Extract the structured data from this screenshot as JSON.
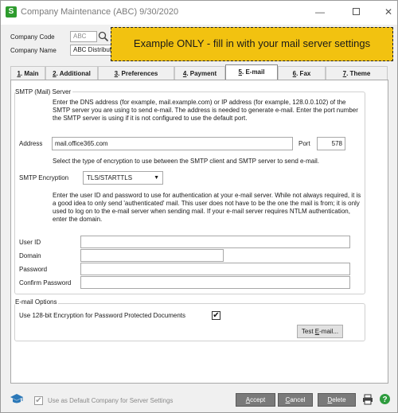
{
  "window": {
    "app_icon_letter": "S",
    "title": "Company Maintenance (ABC) 9/30/2020",
    "controls": {
      "minimize": "—",
      "close": "✕"
    }
  },
  "header": {
    "company_code_label": "Company Code",
    "company_code_value": "ABC",
    "company_name_label": "Company Name",
    "company_name_value": "ABC Distribution"
  },
  "callout": "Example ONLY - fill in with your mail server settings",
  "tabs": [
    {
      "key": "1",
      "label": ". Main"
    },
    {
      "key": "2",
      "label": ". Additional"
    },
    {
      "key": "3",
      "label": ". Preferences"
    },
    {
      "key": "4",
      "label": ". Payment"
    },
    {
      "key": "5",
      "label": ". E-mail"
    },
    {
      "key": "6",
      "label": ". Fax"
    },
    {
      "key": "7",
      "label": ". Theme"
    }
  ],
  "smtp": {
    "group_title": "SMTP (Mail) Server",
    "address_desc": "Enter the DNS address (for example, mail.example.com) or IP address (for example, 128.0.0.102) of the SMTP server you are using to send e-mail. The address is needed to generate e-mail. Enter the port number the SMTP server is using if it is not configured to use the default port.",
    "address_label": "Address",
    "address_value": "mail.office365.com",
    "port_label": "Port",
    "port_value": "578",
    "encryption_desc": "Select the type of encryption to use between the SMTP client and SMTP server to send e-mail.",
    "encryption_label": "SMTP Encryption",
    "encryption_value": "TLS/STARTTLS",
    "auth_desc": "Enter the user ID and password to use for authentication at your e-mail server.  While not always required, it is a good idea to only send 'authenticated' mail.  This user does not have to be the one the mail is from; it is only used to log on to the e-mail server when sending mail.  If your e-mail server requires NTLM authentication, enter the domain.",
    "user_id_label": "User ID",
    "user_id_value": "",
    "domain_label": "Domain",
    "domain_value": "",
    "password_label": "Password",
    "password_value": "",
    "confirm_password_label": "Confirm Password",
    "confirm_password_value": ""
  },
  "email_options": {
    "group_title": "E-mail Options",
    "encryption_pdf_label": "Use 128-bit Encryption for Password Protected Documents",
    "encryption_pdf_checked": "✔",
    "test_button": {
      "pre": "Test ",
      "key": "E",
      "post": "-mail..."
    }
  },
  "footer": {
    "default_company_label": "Use as Default Company for Server Settings",
    "default_company_checked": "✔",
    "accept": {
      "key": "A",
      "post": "ccept"
    },
    "cancel": {
      "key": "C",
      "post": "ancel"
    },
    "delete": {
      "key": "D",
      "post": "elete"
    }
  }
}
